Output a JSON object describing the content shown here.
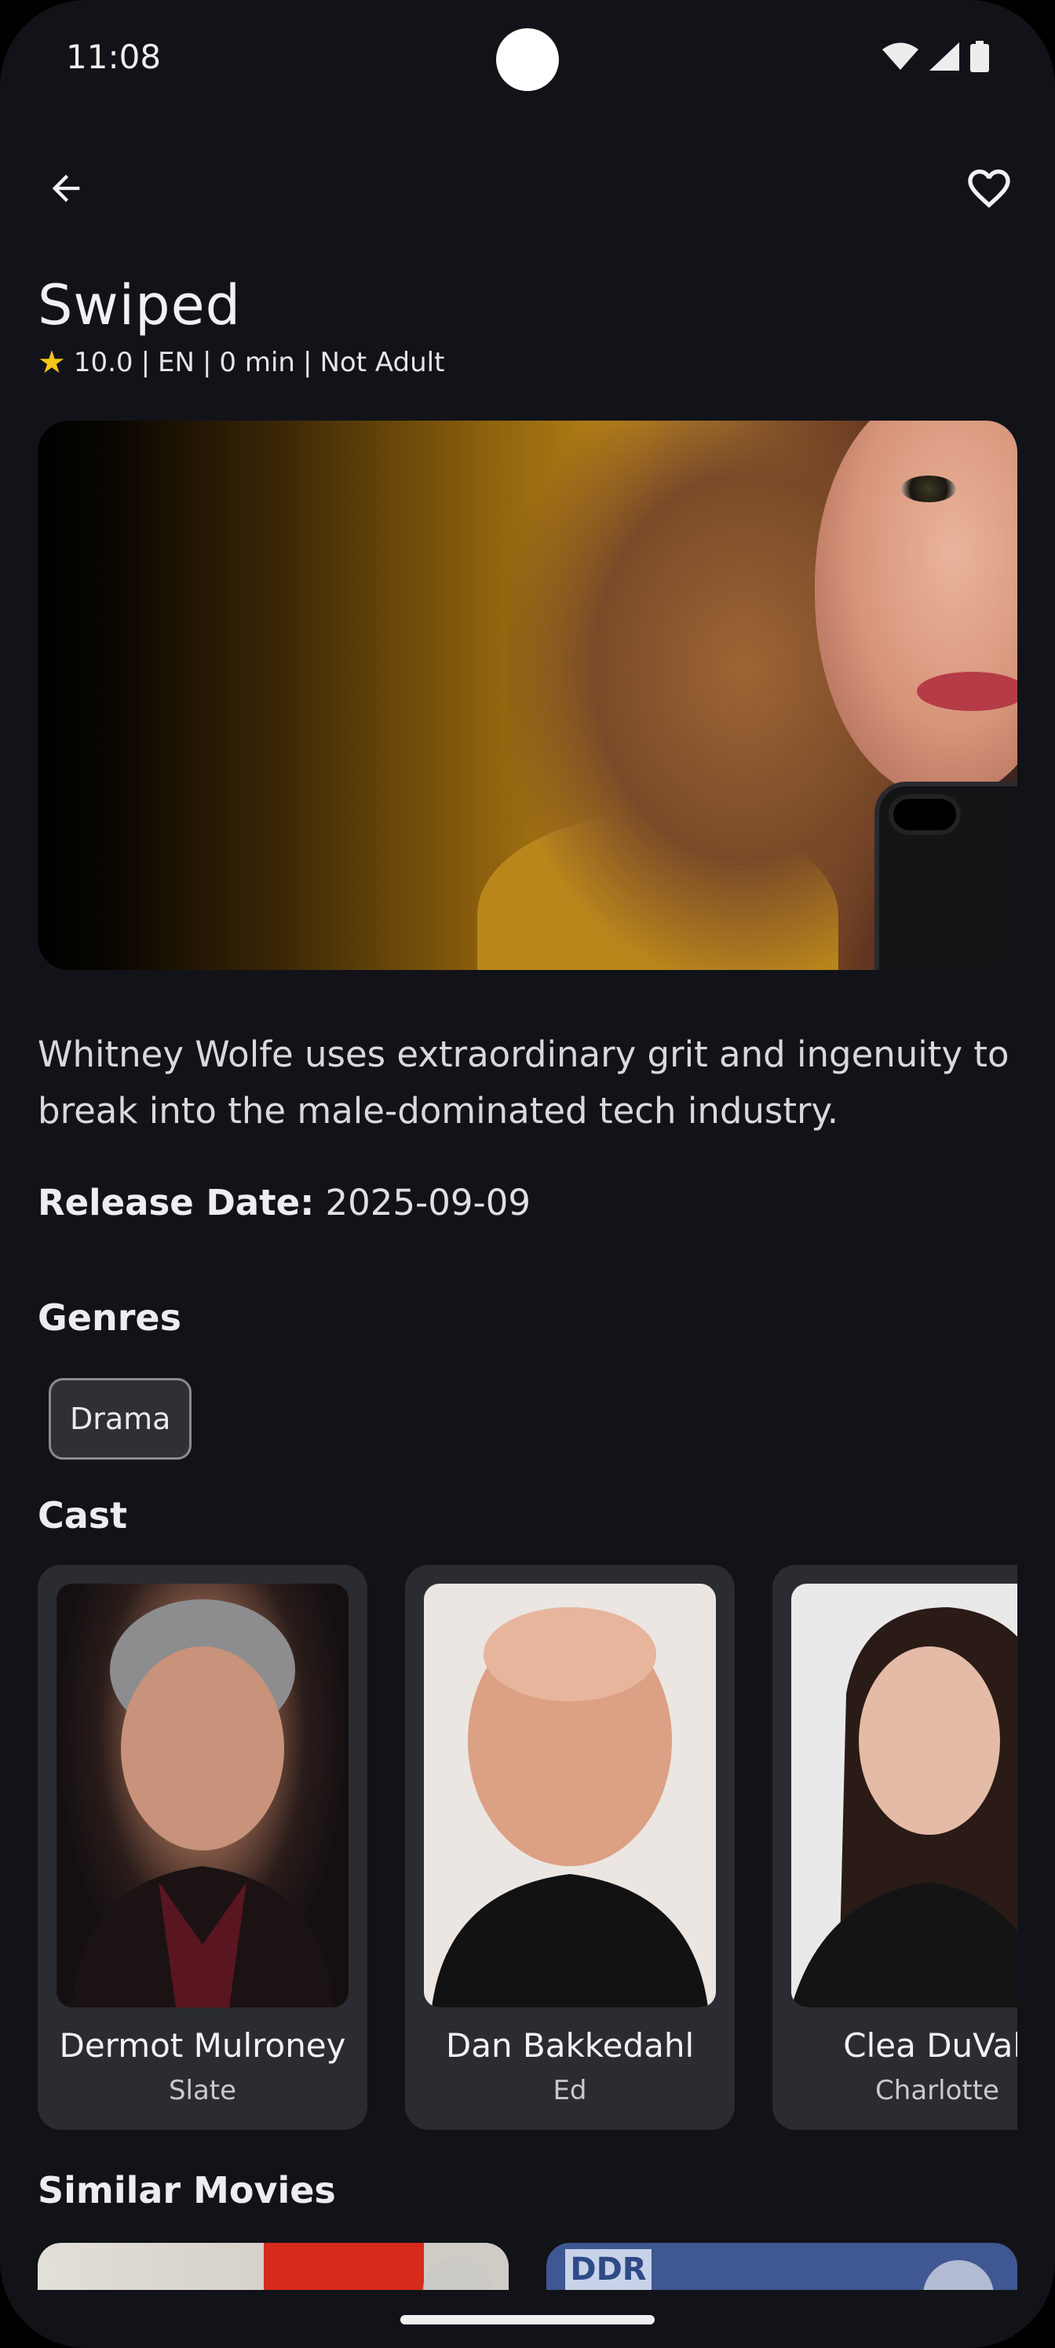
{
  "status_bar": {
    "time": "11:08"
  },
  "app_bar": {
    "back_icon": "arrow-back-icon",
    "favorite_icon": "heart-outline-icon"
  },
  "movie": {
    "title": "Swiped",
    "rating": "10.0",
    "language": "EN",
    "runtime": "0 min",
    "adult": "Not Adult",
    "overview": "Whitney Wolfe uses extraordinary grit and ingenuity to break into the male-dominated tech industry.",
    "release_label": "Release Date:",
    "release_date": "2025-09-09"
  },
  "sections": {
    "genres": "Genres",
    "cast": "Cast",
    "similar": "Similar Movies"
  },
  "genres": [
    "Drama"
  ],
  "cast": [
    {
      "name": "Dermot Mulroney",
      "role": "Slate"
    },
    {
      "name": "Dan Bakkedahl",
      "role": "Ed"
    },
    {
      "name": "Clea DuVall",
      "role": "Charlotte"
    }
  ],
  "similar_movies": [
    {
      "poster_text": ""
    },
    {
      "poster_text": "DDR"
    }
  ],
  "colors": {
    "background": "#121319",
    "card": "#2B2C32",
    "rating_star": "#F5C518"
  }
}
